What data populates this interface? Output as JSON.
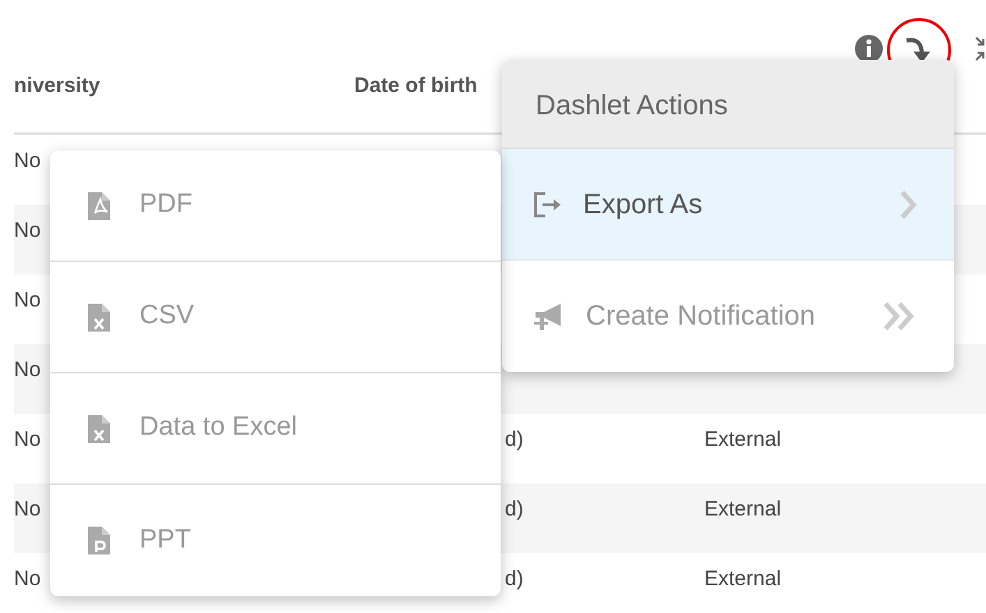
{
  "table": {
    "columns": [
      "niversity",
      "Date of birth"
    ],
    "rows": [
      {
        "cells": [
          "No",
          "",
          ""
        ]
      },
      {
        "cells": [
          "No",
          "",
          ""
        ]
      },
      {
        "cells": [
          "No",
          "",
          ""
        ]
      },
      {
        "cells": [
          "No",
          "",
          ""
        ]
      },
      {
        "cells": [
          "No",
          "d)",
          "External"
        ]
      },
      {
        "cells": [
          "No",
          "d)",
          "External"
        ]
      },
      {
        "cells": [
          "No",
          "d)",
          "External"
        ]
      }
    ]
  },
  "actions_menu": {
    "title": "Dashlet Actions",
    "items": [
      {
        "label": "Export As",
        "kind": "submenu",
        "selected": true
      },
      {
        "label": "Create Notification",
        "kind": "action",
        "selected": false
      }
    ]
  },
  "export_menu": {
    "items": [
      {
        "label": "PDF",
        "kind": "pdf"
      },
      {
        "label": "CSV",
        "kind": "csv"
      },
      {
        "label": "Data to Excel",
        "kind": "excel"
      },
      {
        "label": "PPT",
        "kind": "ppt"
      }
    ]
  }
}
